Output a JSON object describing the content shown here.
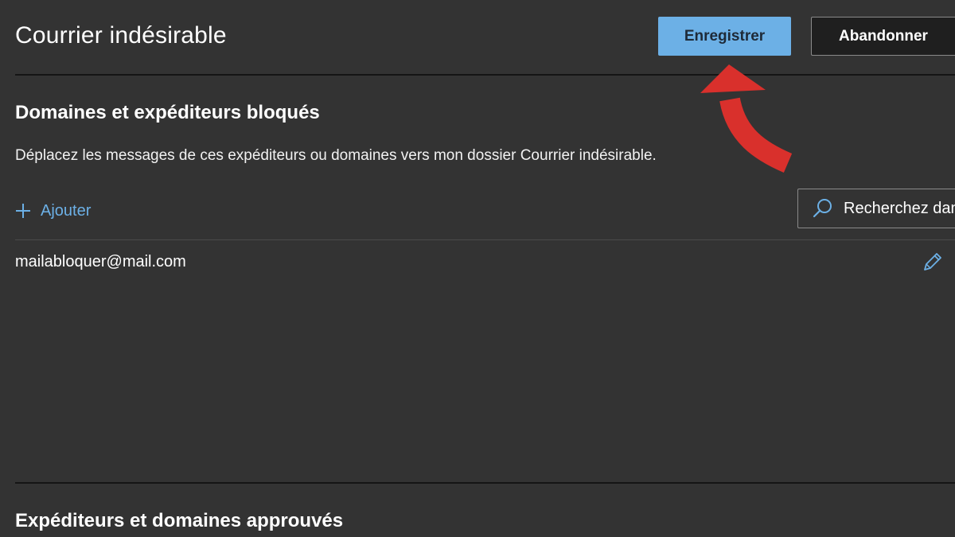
{
  "header": {
    "title": "Courrier indésirable",
    "save_label": "Enregistrer",
    "discard_label": "Abandonner"
  },
  "blocked": {
    "title": "Domaines et expéditeurs bloqués",
    "description": "Déplacez les messages de ces expéditeurs ou domaines vers mon dossier Courrier indésirable.",
    "add_label": "Ajouter",
    "search_placeholder": "Recherchez dans",
    "items": [
      {
        "address": "mailabloquer@mail.com"
      }
    ]
  },
  "approved": {
    "title": "Expéditeurs et domaines approuvés"
  },
  "icons": {
    "add": "plus-icon",
    "search": "search-icon",
    "edit": "pencil-icon",
    "annotation": "red-curved-arrow"
  },
  "colors": {
    "background": "#333333",
    "accent": "#6cb0e6",
    "annotation": "#d9302c"
  }
}
